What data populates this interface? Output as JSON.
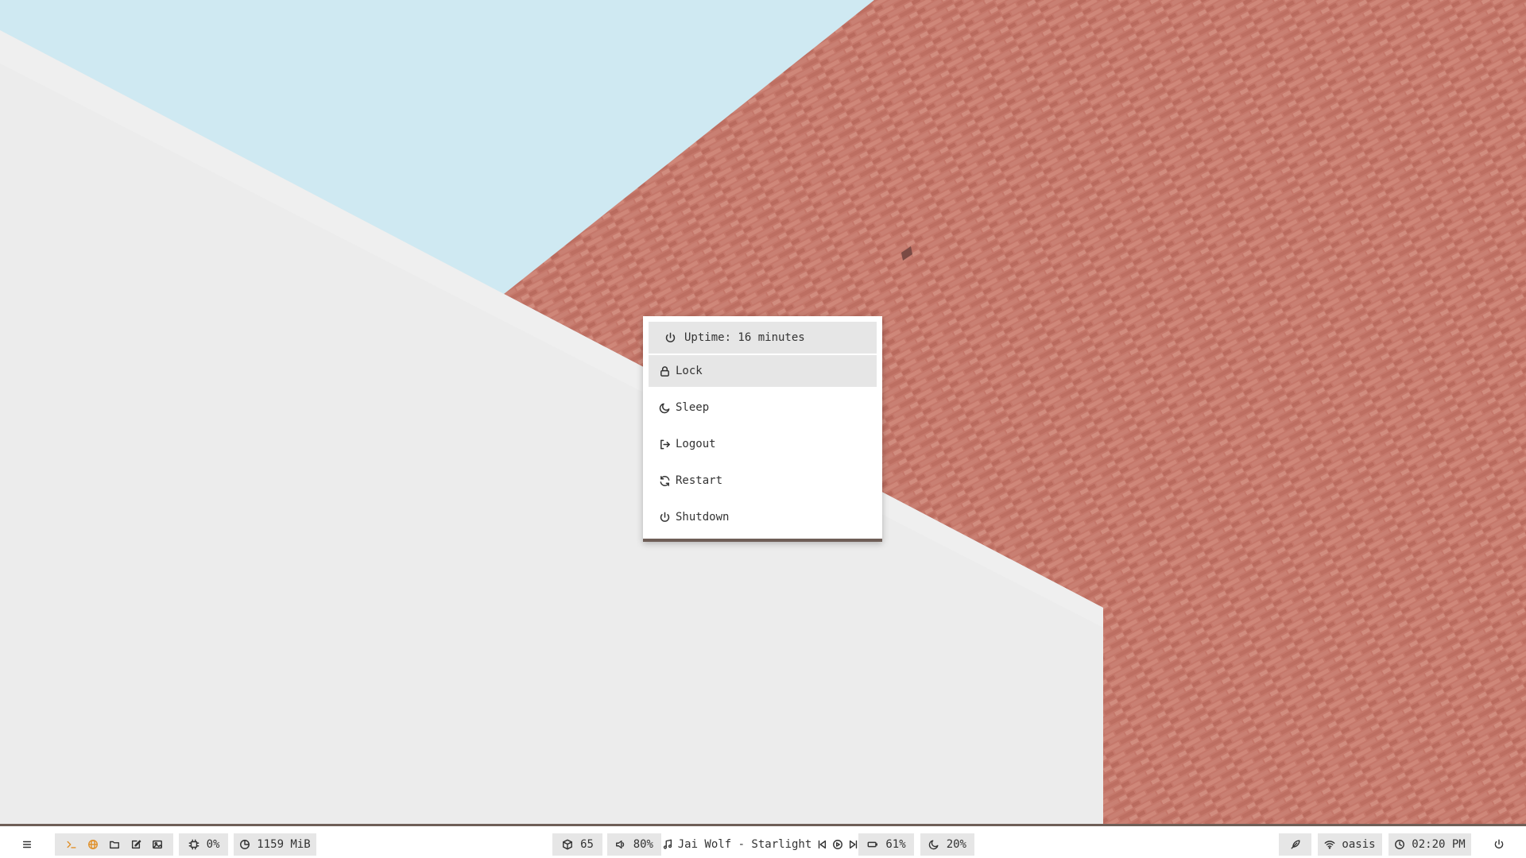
{
  "wallpaper": {
    "sky": "#cfe9f2",
    "brick": "#c5786b",
    "wall": "#ececec"
  },
  "power_menu": {
    "uptime": "Uptime: 16 minutes",
    "items": [
      {
        "label": "Lock",
        "icon": "lock-icon"
      },
      {
        "label": "Sleep",
        "icon": "moon-icon"
      },
      {
        "label": "Logout",
        "icon": "logout-icon"
      },
      {
        "label": "Restart",
        "icon": "refresh-icon"
      },
      {
        "label": "Shutdown",
        "icon": "power-icon"
      }
    ]
  },
  "taskbar": {
    "accent": "#e0902a",
    "border": "#6e5e57",
    "launchers": [
      "terminal-icon",
      "globe-icon",
      "folder-icon",
      "edit-icon",
      "image-icon"
    ],
    "cpu": "0%",
    "memory": "1159 MiB",
    "packages": "65",
    "volume": "80%",
    "media": "Jai Wolf - Starlight",
    "battery": "61%",
    "night_light": "20%",
    "network": "oasis",
    "clock": "02:20 PM"
  }
}
